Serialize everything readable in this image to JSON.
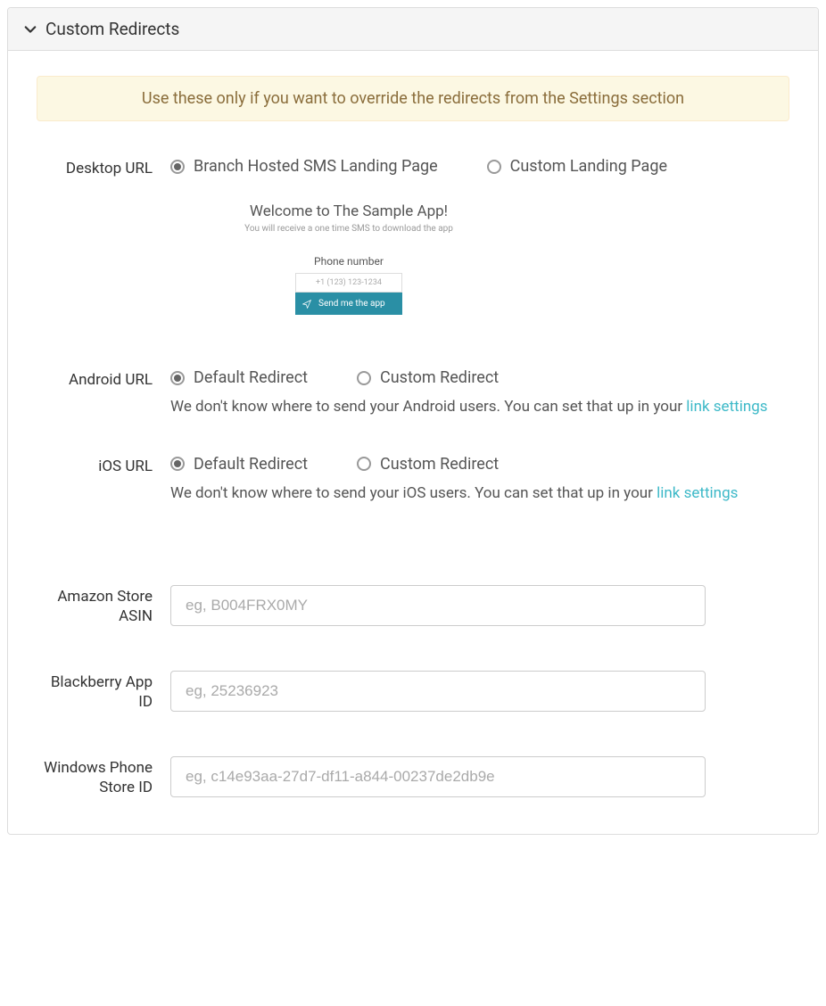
{
  "panel": {
    "title": "Custom Redirects"
  },
  "alert": {
    "text": "Use these only if you want to override the redirects from the Settings section"
  },
  "desktop": {
    "label": "Desktop URL",
    "option1": "Branch Hosted SMS Landing Page",
    "option2": "Custom Landing Page",
    "preview": {
      "title": "Welcome to The Sample App!",
      "subtitle": "You will receive a one time SMS to download the app",
      "phone_label": "Phone number",
      "phone_placeholder": "+1 (123) 123-1234",
      "button": "Send me the app"
    }
  },
  "android": {
    "label": "Android URL",
    "option1": "Default Redirect",
    "option2": "Custom Redirect",
    "hint_prefix": "We don't know where to send your Android users. You can set that up in your ",
    "hint_link": "link settings"
  },
  "ios": {
    "label": "iOS URL",
    "option1": "Default Redirect",
    "option2": "Custom Redirect",
    "hint_prefix": "We don't know where to send your iOS users. You can set that up in your ",
    "hint_link": "link settings"
  },
  "amazon": {
    "label": "Amazon Store ASIN",
    "placeholder": "eg, B004FRX0MY"
  },
  "blackberry": {
    "label": "Blackberry App ID",
    "placeholder": "eg, 25236923"
  },
  "windows": {
    "label": "Windows Phone Store ID",
    "placeholder": "eg, c14e93aa-27d7-df11-a844-00237de2db9e"
  }
}
